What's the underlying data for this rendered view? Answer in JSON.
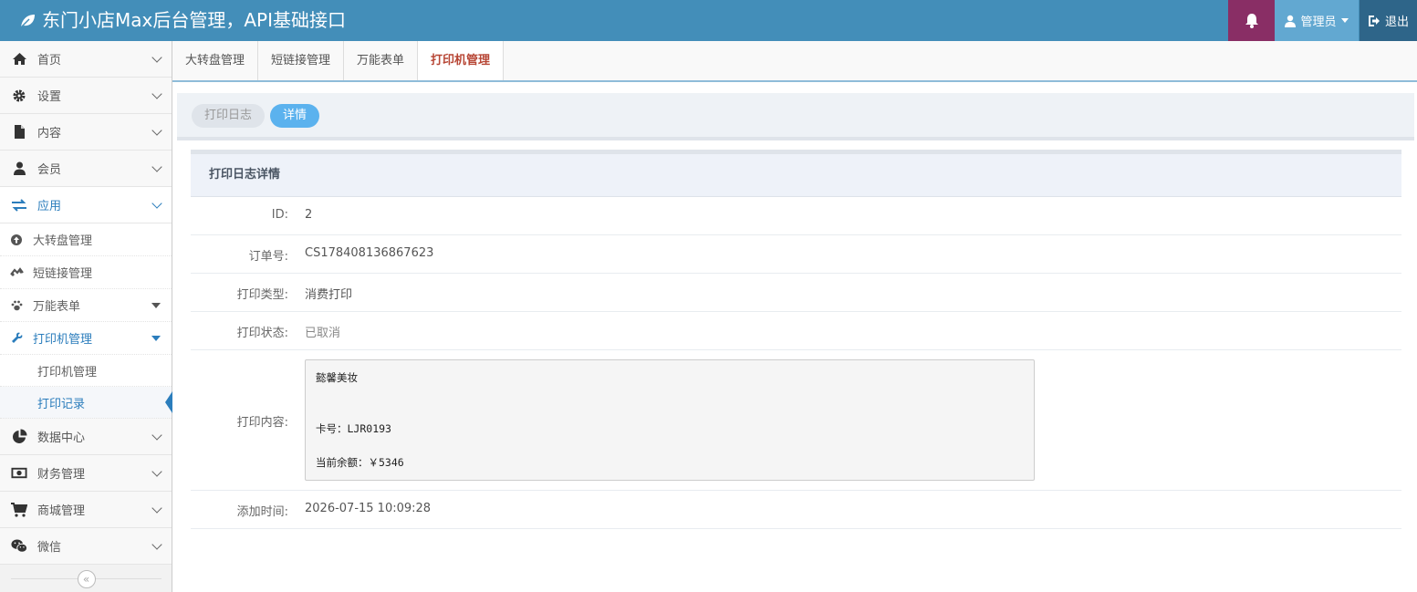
{
  "navbar": {
    "brand_title": "东门小店Max后台管理，API基础接口",
    "user_label": "管理员",
    "logout_label": "退出",
    "colors": {
      "navbar": "#438eb9",
      "bell": "#892e65",
      "user": "#62a8d1",
      "logout": "#2e6589"
    }
  },
  "sidebar": {
    "items": [
      {
        "label": "首页",
        "icon": "home-icon"
      },
      {
        "label": "设置",
        "icon": "gear-icon"
      },
      {
        "label": "内容",
        "icon": "file-icon"
      },
      {
        "label": "会员",
        "icon": "user-icon"
      },
      {
        "label": "应用",
        "icon": "exchange-icon"
      }
    ],
    "app_sub": [
      {
        "label": "大转盘管理",
        "icon": "arrow-up-circle-icon"
      },
      {
        "label": "短链接管理",
        "icon": "link-icon"
      },
      {
        "label": "万能表单",
        "icon": "paw-icon"
      },
      {
        "label": "打印机管理",
        "icon": "wrench-icon"
      }
    ],
    "printer_sub": [
      {
        "label": "打印机管理"
      },
      {
        "label": "打印记录"
      }
    ],
    "items_after": [
      {
        "label": "数据中心",
        "icon": "pie-chart-icon"
      },
      {
        "label": "财务管理",
        "icon": "money-icon"
      },
      {
        "label": "商城管理",
        "icon": "cart-icon"
      },
      {
        "label": "微信",
        "icon": "wechat-icon"
      }
    ]
  },
  "tabs": [
    {
      "label": "大转盘管理"
    },
    {
      "label": "短链接管理"
    },
    {
      "label": "万能表单"
    },
    {
      "label": "打印机管理",
      "active": true
    }
  ],
  "subtabs": {
    "log_label": "打印日志",
    "detail_label": "详情"
  },
  "detail": {
    "title": "打印日志详情",
    "fields": {
      "id": {
        "label": "ID:",
        "value": "2"
      },
      "order_no": {
        "label": "订单号:",
        "value": "CS178408136867623"
      },
      "print_type": {
        "label": "打印类型:",
        "value": "消费打印"
      },
      "print_status": {
        "label": "打印状态:",
        "value": "已取消"
      },
      "print_content": {
        "label": "打印内容:",
        "value": "懿馨美妆\n\n\n卡号：LJR0193\n\n当前余额：￥5346"
      },
      "added_time": {
        "label": "添加时间:",
        "value": "2026-07-15 10:09:28"
      }
    }
  }
}
